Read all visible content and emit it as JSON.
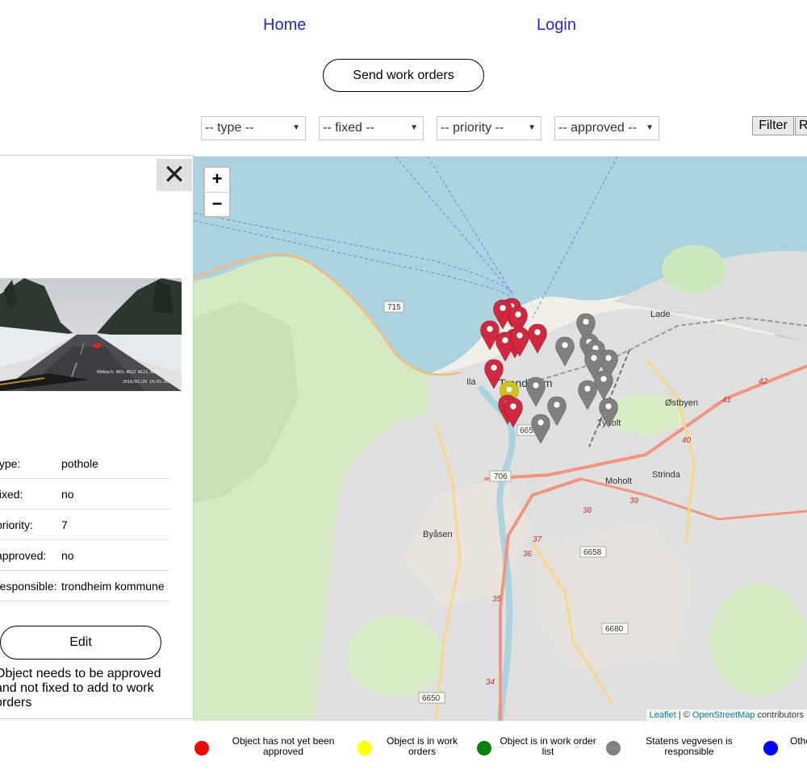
{
  "nav": {
    "home": "Home",
    "login": "Login"
  },
  "actions": {
    "send_work_orders": "Send work orders",
    "filter": "Filter",
    "reset_partial": "R"
  },
  "filters": {
    "type": "-- type --",
    "fixed": "-- fixed --",
    "priority": "-- priority --",
    "approved": "-- approved --"
  },
  "detail": {
    "close_symbol": "✕",
    "photo_caption": "094km/h N63.4622 W121.8816",
    "photo_timestamp": "2016/01/29 14:01:06",
    "rows": [
      {
        "key": "type:",
        "value": "pothole"
      },
      {
        "key": "fixed:",
        "value": "no"
      },
      {
        "key": "priority:",
        "value": "7"
      },
      {
        "key": "approved:",
        "value": "no"
      },
      {
        "key": "responsible:",
        "value": "trondheim kommune"
      }
    ],
    "edit_label": "Edit",
    "note": "Object needs to be approved and not fixed to add to work orders"
  },
  "map": {
    "zoom_in": "+",
    "zoom_out": "−",
    "attribution_leaflet": "Leaflet",
    "attribution_sep": " | © ",
    "attribution_osm": "OpenStreetMap",
    "attribution_rest": " contributors",
    "places": [
      "Lade",
      "Trondheim",
      "Ila",
      "Østbyen",
      "Tyholt",
      "Strinda",
      "Moholt",
      "Byåsen"
    ],
    "roads": [
      "715",
      "706",
      "6659",
      "6658",
      "6680",
      "6650",
      "42",
      "41",
      "40",
      "39",
      "38",
      "37",
      "36",
      "35",
      "34"
    ],
    "markers": {
      "red": 11,
      "yellow": 1,
      "gray": 12
    }
  },
  "legend": [
    {
      "color": "#ff0000",
      "label": "Object has not yet been approved"
    },
    {
      "color": "#ffff00",
      "label": "Object is in work orders"
    },
    {
      "color": "#008000",
      "label": "Object is in work order list"
    },
    {
      "color": "#808080",
      "label": "Statens vegvesen is responsible"
    },
    {
      "color": "#0000ff",
      "label": "Other object"
    }
  ]
}
